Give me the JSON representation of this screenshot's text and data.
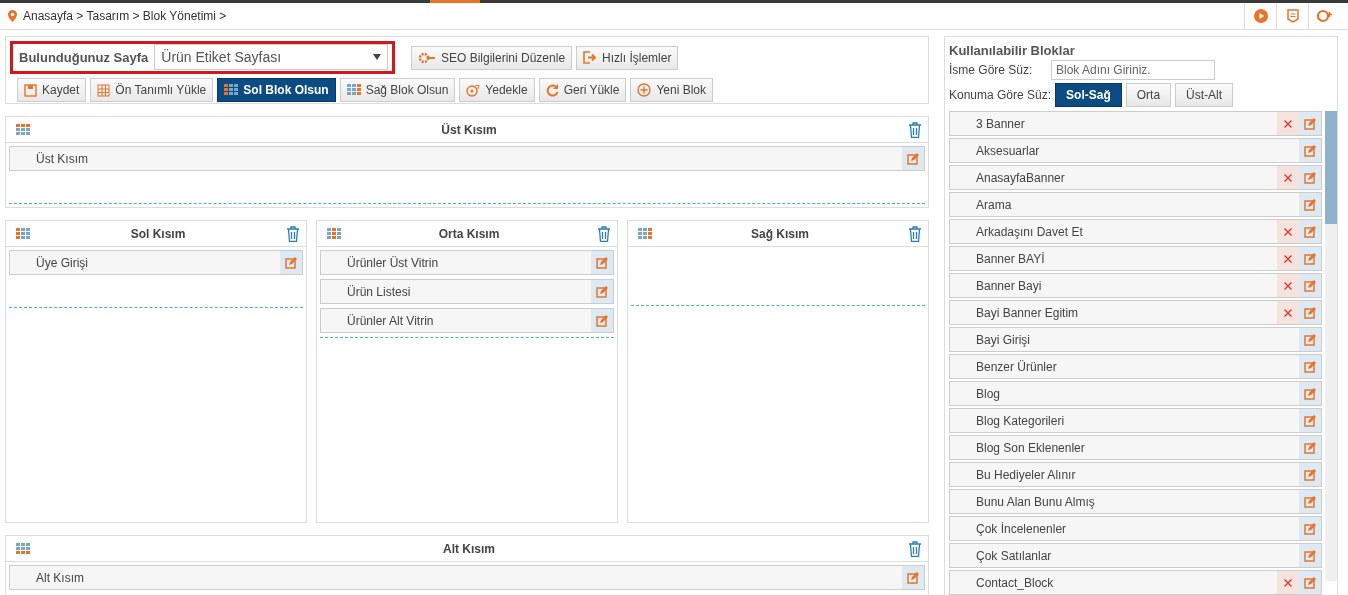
{
  "breadcrumb": "Anasayfa > Tasarım > Blok Yönetimi >",
  "page_select": {
    "label": "Bulunduğunuz Sayfa",
    "value": "Ürün Etiket Sayfası"
  },
  "header_buttons": [
    {
      "label": "SEO Bilgilerini Düzenle",
      "kind": "seo"
    },
    {
      "label": "Hızlı İşlemler",
      "kind": "quick"
    }
  ],
  "toolbar": [
    {
      "label": "Kaydet",
      "kind": "save",
      "selected": false
    },
    {
      "label": "Ön Tanımlı Yükle",
      "kind": "preset",
      "selected": false
    },
    {
      "label": "Sol Blok Olsun",
      "kind": "left",
      "selected": true
    },
    {
      "label": "Sağ Blok Olsun",
      "kind": "right",
      "selected": false
    },
    {
      "label": "Yedekle",
      "kind": "backup",
      "selected": false
    },
    {
      "label": "Geri Yükle",
      "kind": "restore",
      "selected": false
    },
    {
      "label": "Yeni Blok",
      "kind": "new",
      "selected": false
    }
  ],
  "zones": [
    {
      "title": "Üst Kısım",
      "kind": "top",
      "blocks": [
        "Üst Kısım"
      ]
    },
    {
      "title": "Sol Kısım",
      "kind": "left",
      "blocks": [
        "Üye Girişi"
      ]
    },
    {
      "title": "Orta Kısım",
      "kind": "center",
      "blocks": [
        "Ürünler Üst Vitrin",
        "Ürün Listesi",
        "Ürünler Alt Vitrin"
      ]
    },
    {
      "title": "Sağ Kısım",
      "kind": "right"
    },
    {
      "title": "Alt Kısım",
      "kind": "bottom",
      "blocks": [
        "Alt Kısım"
      ]
    }
  ],
  "available": {
    "title": "Kullanılabilir Bloklar",
    "name_filter": {
      "label": "İsme Göre Süz:",
      "placeholder": "Blok Adını Giriniz."
    },
    "position_filter": {
      "label": "Konuma Göre Süz:",
      "options": [
        {
          "label": "Sol-Sağ",
          "selected": true
        },
        {
          "label": "Orta",
          "selected": false
        },
        {
          "label": "Üst-Alt",
          "selected": false
        }
      ]
    },
    "blocks": [
      {
        "name": "3 Banner",
        "deletable": true
      },
      {
        "name": "Aksesuarlar",
        "deletable": false
      },
      {
        "name": "AnasayfaBanner",
        "deletable": true
      },
      {
        "name": "Arama",
        "deletable": false
      },
      {
        "name": "Arkadaşını Davet Et",
        "deletable": true
      },
      {
        "name": "Banner BAYİ",
        "deletable": true
      },
      {
        "name": "Banner Bayi",
        "deletable": true
      },
      {
        "name": "Bayi Banner Egitim",
        "deletable": true
      },
      {
        "name": "Bayi Girişi",
        "deletable": false
      },
      {
        "name": "Benzer Ürünler",
        "deletable": false
      },
      {
        "name": "Blog",
        "deletable": false
      },
      {
        "name": "Blog Kategorileri",
        "deletable": false
      },
      {
        "name": "Blog Son Eklenenler",
        "deletable": false
      },
      {
        "name": "Bu Hediyeler Alınır",
        "deletable": false
      },
      {
        "name": "Bunu Alan Bunu Almış",
        "deletable": false
      },
      {
        "name": "Çok İncelenenler",
        "deletable": false
      },
      {
        "name": "Çok Satılanlar",
        "deletable": false
      },
      {
        "name": "Contact_Block",
        "deletable": true
      }
    ]
  }
}
